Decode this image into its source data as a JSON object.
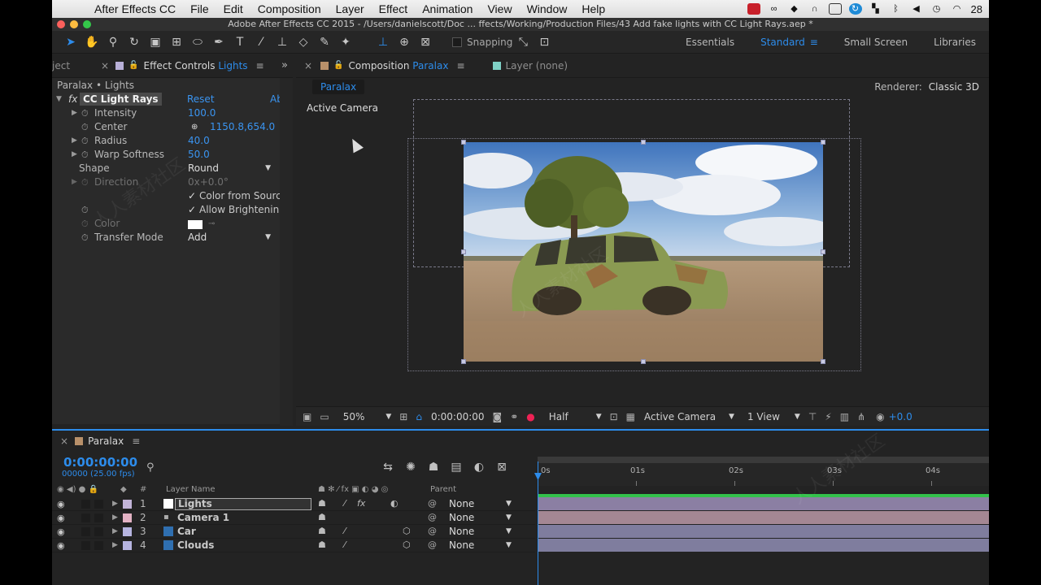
{
  "menubar": {
    "app_name": "After Effects CC",
    "items": [
      "File",
      "Edit",
      "Composition",
      "Layer",
      "Effect",
      "Animation",
      "View",
      "Window",
      "Help"
    ],
    "clock": "28"
  },
  "titlebar": {
    "title": "Adobe After Effects CC 2015 - /Users/danielscott/Doc ... ffects/Working/Production Files/43 Add fake lights with CC Light Rays.aep *"
  },
  "toolbar": {
    "snapping_label": "Snapping",
    "workspaces": [
      "Essentials",
      "Standard",
      "Small Screen",
      "Libraries"
    ],
    "active_workspace": "Standard"
  },
  "effect_controls": {
    "prev_tab": "ject",
    "tab_label": "Effect Controls",
    "tab_target": "Lights",
    "breadcrumb": "Paralax • Lights",
    "effect_name": "CC Light Rays",
    "reset_label": "Reset",
    "about_label": "Ab",
    "properties": [
      {
        "name": "Intensity",
        "value": "100.0"
      },
      {
        "name": "Center",
        "value": "1150.8,654.0"
      },
      {
        "name": "Radius",
        "value": "40.0"
      },
      {
        "name": "Warp Softness",
        "value": "50.0"
      },
      {
        "name": "Shape",
        "value": "Round"
      },
      {
        "name": "Direction",
        "value": "0x+0.0°"
      },
      {
        "name": "",
        "value": "Color from Sourc"
      },
      {
        "name": "",
        "value": "Allow Brightenin"
      },
      {
        "name": "Color",
        "value": ""
      },
      {
        "name": "Transfer Mode",
        "value": "Add"
      }
    ]
  },
  "composition": {
    "tab_label": "Composition",
    "tab_target": "Paralax",
    "layer_tab": "Layer (none)",
    "crumb": "Paralax",
    "renderer_label": "Renderer:",
    "renderer_value": "Classic 3D",
    "view_label": "Active Camera",
    "footer": {
      "zoom": "50%",
      "timecode": "0:00:00:00",
      "resolution": "Half",
      "camera": "Active Camera",
      "views": "1 View",
      "exposure": "+0.0"
    }
  },
  "timeline": {
    "comp_name": "Paralax",
    "timecode": "0:00:00:00",
    "frames": "00000 (25.00 fps)",
    "col_layer_name": "Layer Name",
    "col_parent": "Parent",
    "col_hash": "#",
    "ruler_ticks": [
      "0s",
      "01s",
      "02s",
      "03s",
      "04s"
    ],
    "layers": [
      {
        "num": "1",
        "name": "Lights",
        "parent": "None",
        "color": "#c2b4d8"
      },
      {
        "num": "2",
        "name": "Camera 1",
        "parent": "None",
        "color": "#e3b2c4"
      },
      {
        "num": "3",
        "name": "Car",
        "parent": "None",
        "color": "#b6b4e0"
      },
      {
        "num": "4",
        "name": "Clouds",
        "parent": "None",
        "color": "#b6b4e0"
      }
    ]
  },
  "colors": {
    "accent": "#2d8ceb",
    "panel_bg": "#232323",
    "bar_lights": "#8b7fa3",
    "bar_camera": "#a48793",
    "bar_car": "#7f7d9e",
    "bar_clouds": "#7f7d9e"
  }
}
